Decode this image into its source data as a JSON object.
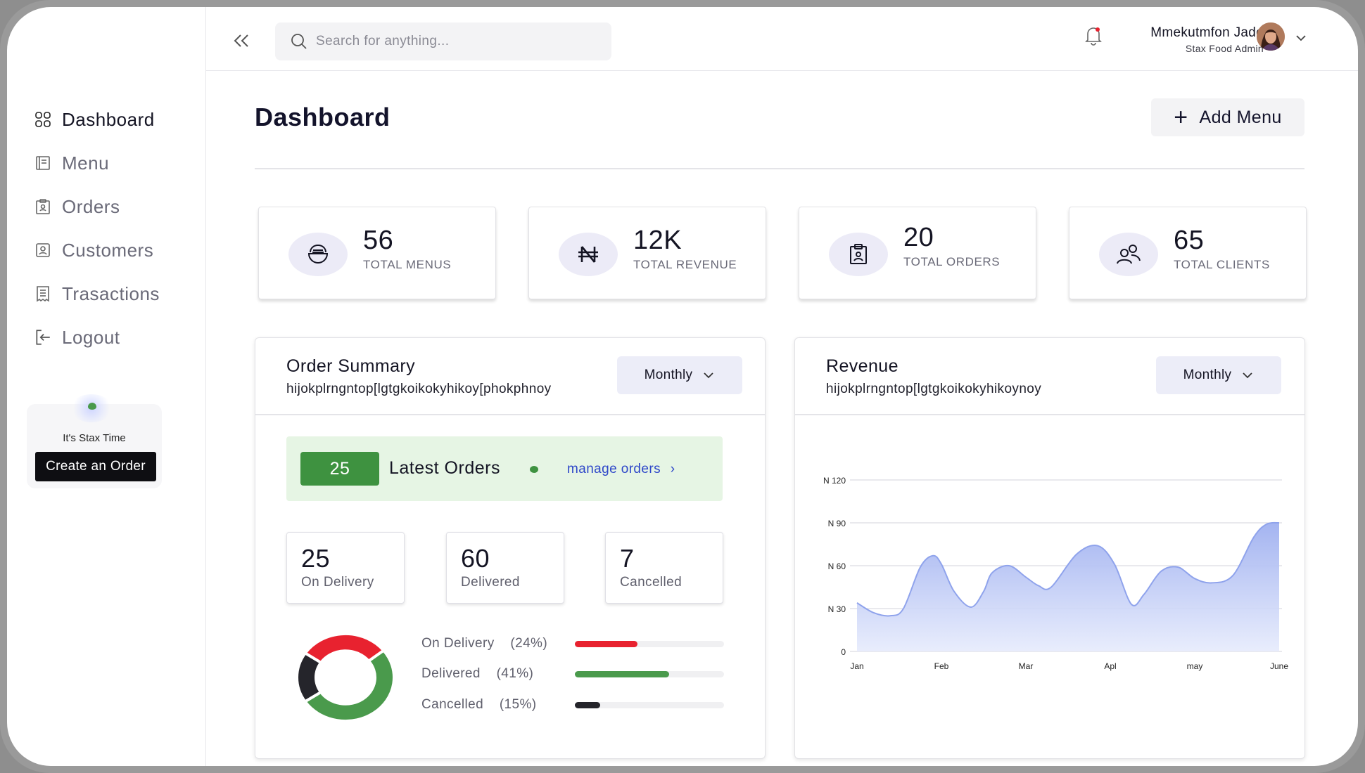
{
  "sidebar": {
    "items": [
      {
        "label": "Dashboard",
        "icon": "grid-icon",
        "active": true
      },
      {
        "label": "Menu",
        "icon": "menu-book-icon"
      },
      {
        "label": "Orders",
        "icon": "clipboard-icon"
      },
      {
        "label": "Customers",
        "icon": "user-card-icon"
      },
      {
        "label": "Trasactions",
        "icon": "receipt-icon"
      },
      {
        "label": "Logout",
        "icon": "logout-icon"
      }
    ],
    "promo": {
      "text": "It's Stax Time",
      "button": "Create an Order"
    }
  },
  "header": {
    "search_placeholder": "Search for anything...",
    "user_name": "Mmekutmfon Jade",
    "user_role": "Stax Food Admin"
  },
  "main": {
    "title": "Dashboard",
    "add_menu_label": "Add Menu",
    "stats": [
      {
        "value": "56",
        "label": "TOTAL MENUS",
        "icon": "food-bowl-icon"
      },
      {
        "value": "12K",
        "label": "TOTAL REVENUE",
        "icon": "naira-icon"
      },
      {
        "value": "20",
        "label": "TOTAL ORDERS",
        "icon": "clipboard-icon"
      },
      {
        "value": "65",
        "label": "TOTAL CLIENTS",
        "icon": "users-icon"
      }
    ]
  },
  "order_summary": {
    "title": "Order Summary",
    "subtitle": "hijokplrngntop[lgtgkoikokyhikoy[phokphnoy",
    "period": "Monthly",
    "latest_count": "25",
    "latest_label": "Latest Orders",
    "manage_link": "manage orders",
    "metrics": [
      {
        "value": "25",
        "label": "On Delivery"
      },
      {
        "value": "60",
        "label": "Delivered"
      },
      {
        "value": "7",
        "label": "Cancelled"
      }
    ],
    "breakdown": [
      {
        "label": "On Delivery",
        "pct_text": "(24%)",
        "percent": 24,
        "bar_fraction": 0.42,
        "color": "#e8222f"
      },
      {
        "label": "Delivered",
        "pct_text": "(41%)",
        "percent": 41,
        "bar_fraction": 0.63,
        "color": "#4a9a4c"
      },
      {
        "label": "Cancelled",
        "pct_text": "(15%)",
        "percent": 15,
        "bar_fraction": 0.17,
        "color": "#25252b"
      }
    ]
  },
  "revenue": {
    "title": "Revenue",
    "subtitle": "hijokplrngntop[lgtgkoikokyhikoynoy",
    "period": "Monthly"
  },
  "chart_data": {
    "type": "area",
    "x": [
      "Jan",
      "Feb",
      "Mar",
      "Apl",
      "may",
      "June"
    ],
    "y_ticks": [
      "0",
      "N 30",
      "N 60",
      "N 90",
      "N 120"
    ],
    "ylim": [
      0,
      120
    ],
    "grid": true,
    "series": [
      {
        "x": [
          0,
          0.2,
          0.4,
          0.55,
          0.75,
          0.9,
          1.0,
          1.15,
          1.35,
          1.5,
          1.6,
          1.8,
          2.0,
          2.15,
          2.3,
          2.6,
          2.85,
          3.05,
          3.25,
          3.4,
          3.6,
          3.8,
          4.0,
          4.2,
          4.45,
          4.7,
          4.85,
          5.0
        ],
        "y": [
          34,
          27,
          25,
          30,
          59,
          67,
          61,
          42,
          31,
          42,
          55,
          60,
          52,
          46,
          45,
          68,
          74,
          61,
          33,
          40,
          56,
          59,
          51,
          48,
          53,
          80,
          89,
          90
        ]
      }
    ],
    "fill_color": "#9fb0f0",
    "line_color": "#8fa3ec"
  }
}
